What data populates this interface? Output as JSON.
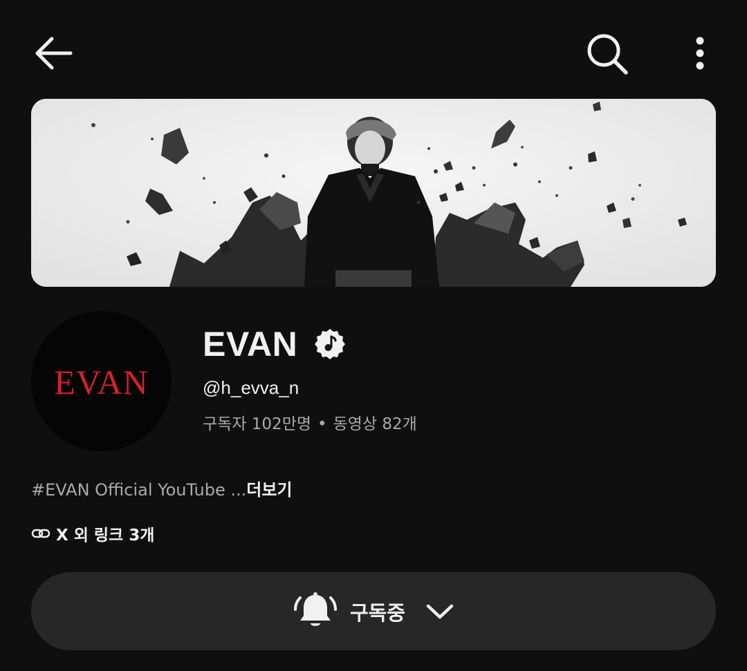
{
  "channel": {
    "name": "EVAN",
    "handle": "@h_evva_n",
    "subscribers": "구독자 102만명",
    "separator": "•",
    "videos": "동영상 82개",
    "avatar_logo_text": "EVAN",
    "verified_icon": "music-note-badge-icon"
  },
  "description": {
    "text": "#EVAN Official YouTube ...",
    "more_label": "더보기"
  },
  "links": {
    "label": "X 외 링크 3개",
    "icon": "link-icon"
  },
  "subscribe": {
    "label": "구독중",
    "icon": "bell-icon"
  },
  "topbar": {
    "back_icon": "arrow-left-icon",
    "search_icon": "search-icon",
    "more_icon": "more-vertical-icon"
  },
  "colors": {
    "background": "#0f0f0f",
    "button_bg": "#272727",
    "logo_red": "#d3212c",
    "muted_text": "#aaaaaa"
  }
}
